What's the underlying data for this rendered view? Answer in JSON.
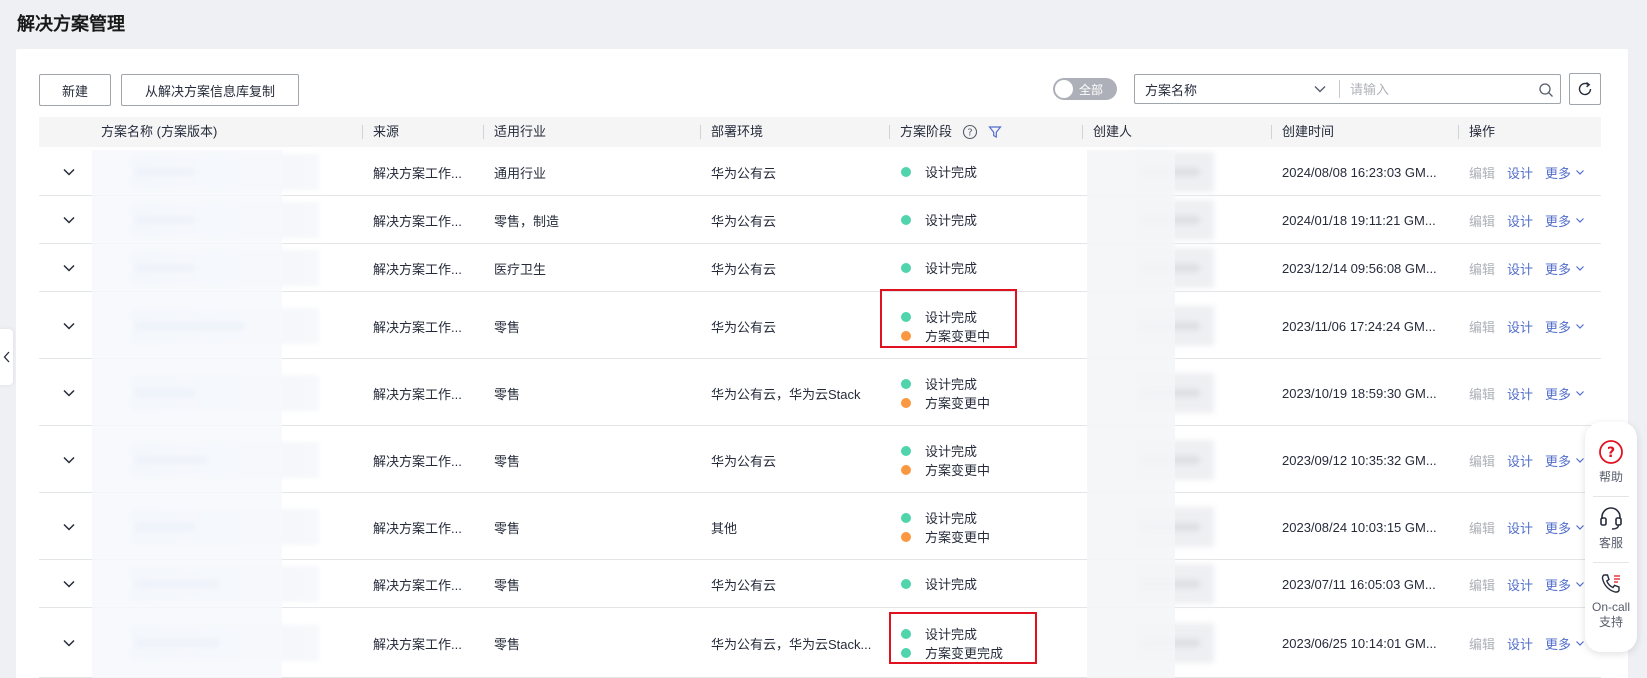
{
  "page_title": "解决方案管理",
  "toolbar": {
    "new_label": "新建",
    "copy_label": "从解决方案信息库复制",
    "toggle_label": "全部",
    "select_value": "方案名称",
    "search_placeholder": "请输入"
  },
  "table": {
    "headers": {
      "name": "方案名称 (方案版本)",
      "source": "来源",
      "industry": "适用行业",
      "env": "部署环境",
      "stage": "方案阶段",
      "creator": "创建人",
      "created": "创建时间",
      "ops": "操作"
    },
    "actions": {
      "edit": "编辑",
      "design": "设计",
      "more": "更多"
    },
    "rows": [
      {
        "source": "解决方案工作...",
        "industry": "通用行业",
        "env": "华为公有云",
        "stages": [
          {
            "label": "设计完成",
            "color": "green"
          }
        ],
        "created": "2024/08/08 16:23:03 GM..."
      },
      {
        "source": "解决方案工作...",
        "industry": "零售，制造",
        "env": "华为公有云",
        "stages": [
          {
            "label": "设计完成",
            "color": "green"
          }
        ],
        "created": "2024/01/18 19:11:21 GM..."
      },
      {
        "source": "解决方案工作...",
        "industry": "医疗卫生",
        "env": "华为公有云",
        "stages": [
          {
            "label": "设计完成",
            "color": "green"
          }
        ],
        "created": "2023/12/14 09:56:08 GM..."
      },
      {
        "source": "解决方案工作...",
        "industry": "零售",
        "env": "华为公有云",
        "stages": [
          {
            "label": "设计完成",
            "color": "green"
          },
          {
            "label": "方案变更中",
            "color": "orange"
          }
        ],
        "created": "2023/11/06 17:24:24 GM..."
      },
      {
        "source": "解决方案工作...",
        "industry": "零售",
        "env": "华为公有云，华为云Stack",
        "stages": [
          {
            "label": "设计完成",
            "color": "green"
          },
          {
            "label": "方案变更中",
            "color": "orange"
          }
        ],
        "created": "2023/10/19 18:59:30 GM..."
      },
      {
        "source": "解决方案工作...",
        "industry": "零售",
        "env": "华为公有云",
        "stages": [
          {
            "label": "设计完成",
            "color": "green"
          },
          {
            "label": "方案变更中",
            "color": "orange"
          }
        ],
        "created": "2023/09/12 10:35:32 GM..."
      },
      {
        "source": "解决方案工作...",
        "industry": "零售",
        "env": "其他",
        "stages": [
          {
            "label": "设计完成",
            "color": "green"
          },
          {
            "label": "方案变更中",
            "color": "orange"
          }
        ],
        "created": "2023/08/24 10:03:15 GM..."
      },
      {
        "source": "解决方案工作...",
        "industry": "零售",
        "env": "华为公有云",
        "stages": [
          {
            "label": "设计完成",
            "color": "green"
          }
        ],
        "created": "2023/07/11 16:05:03 GM..."
      },
      {
        "source": "解决方案工作...",
        "industry": "零售",
        "env": "华为公有云，华为云Stack...",
        "stages": [
          {
            "label": "设计完成",
            "color": "green"
          },
          {
            "label": "方案变更完成",
            "color": "green"
          }
        ],
        "created": "2023/06/25 10:14:01 GM..."
      }
    ]
  },
  "float_panel": {
    "help": "帮助",
    "service": "客服",
    "oncall_1": "On-call",
    "oncall_2": "支持"
  },
  "colors": {
    "highlight": "#e0121f",
    "link": "#526ecc",
    "stage_green": "#50d4ab",
    "stage_orange": "#fa9841"
  }
}
